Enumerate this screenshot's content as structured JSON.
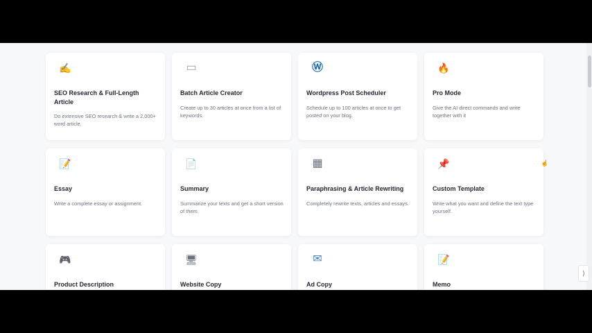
{
  "cards": [
    {
      "icon": "✍️",
      "icon_name": "writing-hand-icon",
      "title": "SEO Research & Full-Length Article",
      "desc": "Do extensive SEO research & write a 2,000+ word article."
    },
    {
      "icon": "▭",
      "icon_name": "keyboard-icon",
      "title": "Batch Article Creator",
      "desc": "Create up to 30 articles at once from a list of keywords."
    },
    {
      "icon": "Ⓦ",
      "icon_name": "wordpress-icon",
      "title": "Wordpress Post Scheduler",
      "desc": "Schedule up to 100 articles at once to get posted on your blog."
    },
    {
      "icon": "🔥",
      "icon_name": "fire-icon",
      "title": "Pro Mode",
      "desc": "Give the AI direct commands and write together with it"
    },
    {
      "icon": "📝",
      "icon_name": "memo-icon",
      "title": "Essay",
      "desc": "Write a complete essay or assignment."
    },
    {
      "icon": "📄",
      "icon_name": "document-icon",
      "title": "Summary",
      "desc": "Summarize your texts and get a short version of them."
    },
    {
      "icon": "▦",
      "icon_name": "calendar-icon",
      "title": "Paraphrasing & Article Rewriting",
      "desc": "Completely rewrite texts, articles and essays."
    },
    {
      "icon": "📌",
      "icon_name": "pushpin-icon",
      "title": "Custom Template",
      "desc": "Write what you want and define the text type yourself."
    },
    {
      "icon": "🎮",
      "icon_name": "game-controller-icon",
      "title": "Product Description",
      "desc": ""
    },
    {
      "icon": "🖥",
      "icon_name": "website-icon",
      "title": "Website Copy",
      "desc": ""
    },
    {
      "icon": "✉",
      "icon_name": "envelope-icon",
      "title": "Ad Copy",
      "desc": ""
    },
    {
      "icon": "📝",
      "icon_name": "memo-pencil-icon",
      "title": "Memo",
      "desc": ""
    }
  ]
}
